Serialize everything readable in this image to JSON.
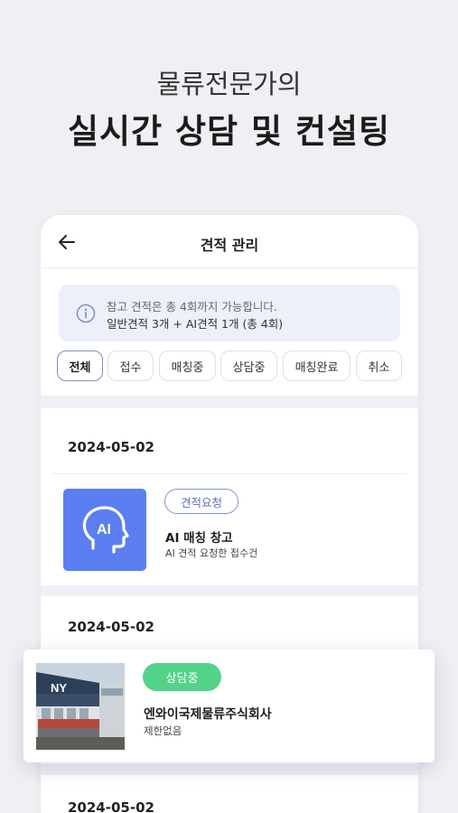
{
  "hero": {
    "subtitle": "물류전문가의",
    "title": "실시간 상담 및 컨설팅"
  },
  "header": {
    "back_icon": "arrow-left-icon",
    "title": "견적 관리"
  },
  "notice": {
    "icon": "info-icon",
    "line1": "참고 견적은 총 4회까지 가능합니다.",
    "line2": "일반견적 3개 + AI견적 1개 (총 4회)"
  },
  "filters": [
    "전체",
    "접수",
    "매칭중",
    "상담중",
    "매칭완료",
    "취소"
  ],
  "filters_selected": "전체",
  "groups": [
    {
      "date": "2024-05-02",
      "card": {
        "thumb_text": "AI",
        "thumb_icon": "ai-head-icon",
        "badge": "견적요청",
        "title": "AI 매칭 창고",
        "subtitle": "AI 견적 요청한 접수건"
      }
    },
    {
      "date": "2024-05-02",
      "card": {
        "photo_text": "NY",
        "badge": "상담중",
        "title": "엔와이국제물류주식회사",
        "subtitle": "제한없음"
      }
    },
    {
      "date": "2024-05-02"
    }
  ],
  "colors": {
    "background": "#eff0f4",
    "ai_blue": "#5b7ff0",
    "badge_outline": "#7f94d4",
    "badge_green": "#53d28a",
    "notice_bg": "#edf0f9"
  }
}
